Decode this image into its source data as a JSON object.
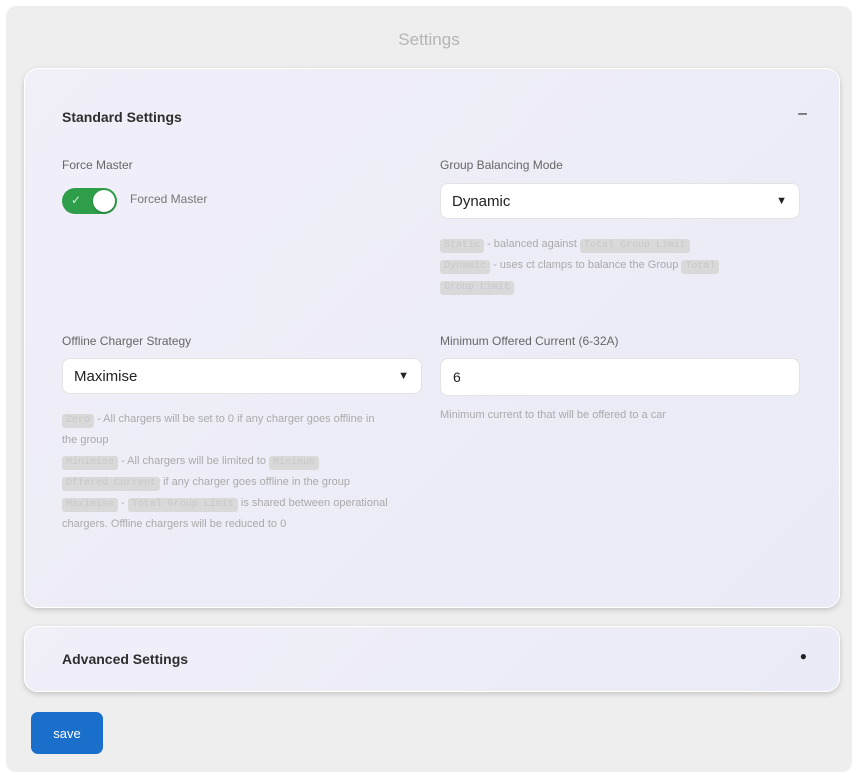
{
  "page": {
    "title": "Settings"
  },
  "standard": {
    "header": "Standard Settings",
    "collapse_glyph": "–",
    "force_master": {
      "label": "Force Master",
      "switch_label": "Forced Master",
      "on": true
    },
    "group_balancing": {
      "label": "Group Balancing Mode",
      "value": "Dynamic",
      "help": {
        "static_code": "Static",
        "static_text": " - balanced against ",
        "static_limit_code": "Total Group Limit",
        "dynamic_code": "Dynamic",
        "dynamic_text": " - uses ct clamps to balance the Group ",
        "dynamic_total_code": "Total",
        "dynamic_limit_code": "Group Limit"
      }
    },
    "offline_strategy": {
      "label": "Offline Charger Strategy",
      "value": "Maximise",
      "help": {
        "zero_code": "Zero",
        "zero_text": " - All chargers will be set to 0 if any charger goes offline in the group",
        "minimise_code": "Minimise",
        "minimise_text": " - All chargers will be limited to ",
        "minimum_code": "Minimum",
        "offered_current_code": "Offered Current",
        "minimise_tail": " if any charger goes offline in the group",
        "maximise_code": "Maximise",
        "maximise_dash": " - ",
        "maximise_limit_code": "Total Group Limit",
        "maximise_text": " is shared between operational chargers. Offline chargers will be reduced to 0"
      }
    },
    "min_offered_current": {
      "label": "Minimum Offered Current (6-32A)",
      "value": "6",
      "help": "Minimum current to that will be offered to a car"
    }
  },
  "advanced": {
    "header": "Advanced Settings",
    "expand_glyph": "●"
  },
  "save_label": "save"
}
